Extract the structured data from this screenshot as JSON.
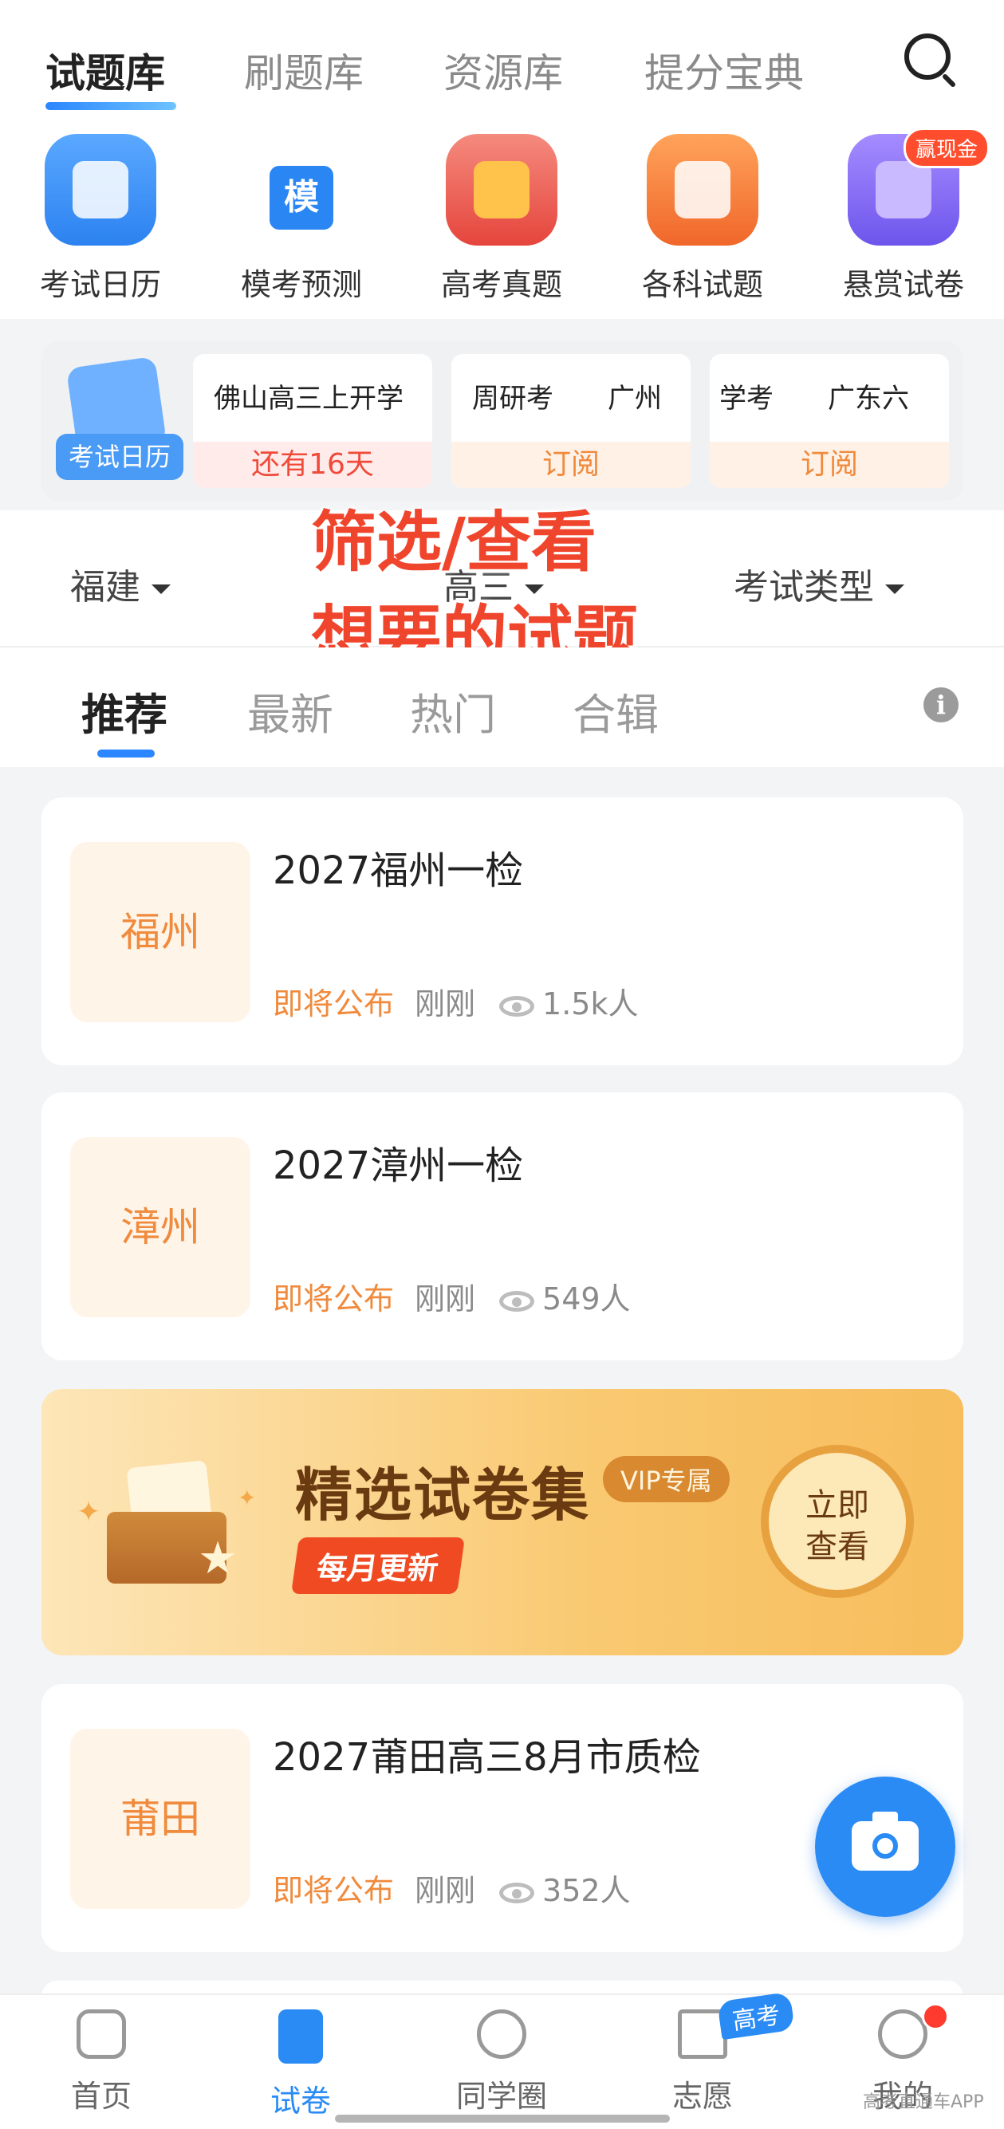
{
  "top_tabs": [
    "试题库",
    "刷题库",
    "资源库",
    "提分宝典"
  ],
  "quick_actions": [
    {
      "label": "考试日历",
      "icon": "calendar-icon",
      "color": "#3b8df6"
    },
    {
      "label": "模考预测",
      "icon": "mock-exam-icon",
      "color": "#2a86f3"
    },
    {
      "label": "高考真题",
      "icon": "real-exam-icon",
      "color": "#ef5d54"
    },
    {
      "label": "各科试题",
      "icon": "subject-search-icon",
      "color": "#f27a36"
    },
    {
      "label": "悬赏试卷",
      "icon": "reward-upload-icon",
      "color": "#8a6df2"
    }
  ],
  "mock_icon_glyph": "模",
  "cash_badge": "赢现金",
  "calendar": {
    "tag": "考试日历",
    "cards": [
      {
        "title": "佛山高三上开学",
        "action": "还有16天"
      },
      {
        "title": "周研考　　广州",
        "action": "订阅"
      },
      {
        "title": "学考　　广东六",
        "action": "订阅"
      }
    ]
  },
  "filters": {
    "province": "福建",
    "grade": "高三",
    "exam_type": "考试类型"
  },
  "overlay_caption": [
    "筛选/查看",
    "想要的试题"
  ],
  "sub_tabs": [
    "推荐",
    "最新",
    "热门",
    "合辑"
  ],
  "info_glyph": "i",
  "exam_list": [
    {
      "region": "福州",
      "title": "2027福州一检",
      "status": "即将公布",
      "time": "刚刚",
      "views": "1.5k人"
    },
    {
      "region": "漳州",
      "title": "2027漳州一检",
      "status": "即将公布",
      "time": "刚刚",
      "views": "549人"
    },
    {
      "region": "莆田",
      "title": "2027莆田高三8月市质检",
      "status": "即将公布",
      "time": "刚刚",
      "views": "352人"
    }
  ],
  "banner": {
    "title": "精选试卷集",
    "vip": "VIP专属",
    "monthly": "每月更新",
    "cta_line1": "立即",
    "cta_line2": "查看"
  },
  "bottom_nav": [
    {
      "label": "首页",
      "icon": "home-icon"
    },
    {
      "label": "试卷",
      "icon": "paper-icon"
    },
    {
      "label": "同学圈",
      "icon": "chat-icon"
    },
    {
      "label": "志愿",
      "icon": "graduation-cap-icon"
    },
    {
      "label": "我的",
      "icon": "profile-icon"
    }
  ],
  "gaokao_badge": "高考",
  "watermark": "高考直通车APP",
  "colors": {
    "accent": "#2a8bf5",
    "orange": "#f08a3c",
    "highlight_red": "#f0452d"
  }
}
